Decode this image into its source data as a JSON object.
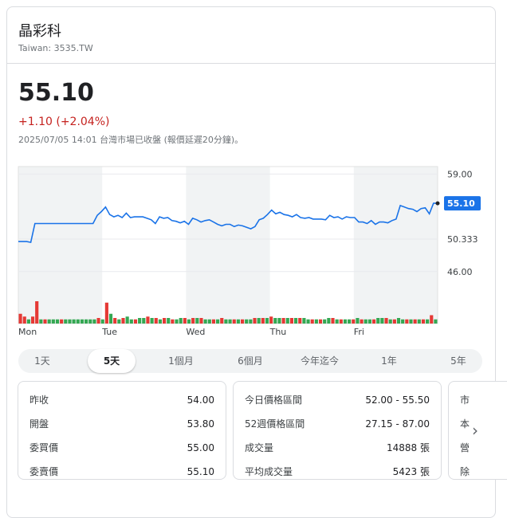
{
  "header": {
    "name": "晶彩科",
    "ticker": "Taiwan: 3535.TW"
  },
  "quote": {
    "price": "55.10",
    "change": "+1.10 (+2.04%)",
    "timestamp": "2025/07/05 14:01 台灣市場已收盤 (報價延遲20分鐘)。"
  },
  "colors": {
    "line": "#1a73e8",
    "up": "#e53935",
    "down": "#34a853",
    "band": "#f1f3f4"
  },
  "chart_data": {
    "type": "line",
    "ylim": [
      43,
      60
    ],
    "ytick_labels": [
      "59.00",
      "50.333",
      "46.00"
    ],
    "yticks": [
      59.0,
      50.333,
      46.0
    ],
    "x_labels": [
      "Mon",
      "Tue",
      "Wed",
      "Thu",
      "Fri"
    ],
    "last_price_label": "55.10",
    "grid": true,
    "series": [
      {
        "values": [
          50.0,
          50.0,
          50.0,
          49.9,
          52.4,
          52.4,
          52.4,
          52.4,
          52.4,
          52.4,
          52.4,
          52.4,
          52.4,
          52.4,
          52.4,
          52.4,
          52.4,
          52.4,
          52.4,
          53.5,
          54.0,
          54.6,
          53.6,
          53.3,
          53.5,
          53.2,
          53.8,
          53.2,
          53.3,
          53.3,
          53.3,
          53.1,
          52.9,
          52.4,
          53.3,
          53.1,
          53.2,
          52.8,
          52.7,
          52.5,
          52.7,
          52.3,
          53.1,
          52.9,
          52.6,
          52.8,
          52.9,
          52.6,
          52.3,
          52.1,
          52.3,
          52.3,
          52.0,
          52.2,
          52.1,
          51.9,
          51.7,
          52.0,
          52.9,
          53.1,
          53.6,
          54.2,
          53.7,
          53.9,
          53.6,
          53.5,
          53.3,
          53.6,
          53.2,
          53.1,
          53.2,
          53.0,
          53.0,
          53.0,
          52.9,
          53.5,
          53.2,
          53.3,
          53.0,
          53.3,
          53.2,
          53.2,
          52.6,
          52.6,
          52.4,
          52.8,
          52.3,
          52.6,
          52.6,
          52.5,
          52.8,
          53.0,
          54.8,
          54.6,
          54.4,
          54.3,
          54.0,
          54.4,
          54.5,
          53.7,
          55.1,
          55.1
        ]
      }
    ],
    "volume": {
      "up": [
        true,
        true,
        false,
        true,
        true,
        false,
        true,
        false,
        false,
        false,
        true,
        false,
        false,
        false,
        false,
        false,
        false,
        false,
        false,
        true,
        false,
        true,
        false,
        true,
        false,
        true,
        false,
        false,
        true,
        false,
        false,
        true,
        false,
        true,
        false,
        true,
        false,
        true,
        false,
        false,
        true,
        false,
        true,
        false,
        true,
        false,
        false,
        true,
        false,
        true,
        false,
        false,
        true,
        false,
        true,
        false,
        false,
        true,
        false,
        true,
        false,
        true,
        false,
        false,
        true,
        false,
        true,
        false,
        true,
        false,
        false,
        true,
        false,
        true,
        false,
        false,
        true,
        false,
        true,
        false,
        false,
        true,
        false,
        true,
        false,
        false,
        true,
        false,
        false,
        true,
        false,
        true,
        false,
        false,
        true,
        false,
        true,
        false,
        true,
        false,
        true,
        false
      ],
      "values": [
        0.35,
        0.25,
        0.15,
        0.25,
        0.8,
        0.15,
        0.15,
        0.15,
        0.15,
        0.15,
        0.15,
        0.15,
        0.15,
        0.15,
        0.15,
        0.15,
        0.15,
        0.15,
        0.15,
        0.2,
        0.15,
        0.75,
        0.35,
        0.2,
        0.15,
        0.2,
        0.25,
        0.15,
        0.15,
        0.2,
        0.2,
        0.25,
        0.2,
        0.2,
        0.15,
        0.2,
        0.2,
        0.15,
        0.15,
        0.2,
        0.2,
        0.15,
        0.2,
        0.2,
        0.2,
        0.15,
        0.15,
        0.15,
        0.15,
        0.2,
        0.15,
        0.15,
        0.15,
        0.15,
        0.15,
        0.15,
        0.15,
        0.2,
        0.2,
        0.2,
        0.2,
        0.25,
        0.2,
        0.2,
        0.2,
        0.2,
        0.2,
        0.2,
        0.2,
        0.2,
        0.15,
        0.15,
        0.15,
        0.15,
        0.15,
        0.2,
        0.2,
        0.15,
        0.15,
        0.15,
        0.15,
        0.15,
        0.2,
        0.15,
        0.15,
        0.15,
        0.15,
        0.2,
        0.2,
        0.2,
        0.15,
        0.15,
        0.2,
        0.15,
        0.15,
        0.15,
        0.15,
        0.15,
        0.15,
        0.15,
        0.3,
        0.15
      ]
    }
  },
  "range_tabs": [
    "1天",
    "5天",
    "1個月",
    "6個月",
    "今年迄今",
    "1年",
    "5年"
  ],
  "active_range": "5天",
  "stats_left": [
    {
      "label": "昨收",
      "value": "54.00"
    },
    {
      "label": "開盤",
      "value": "53.80"
    },
    {
      "label": "委買價",
      "value": "55.00"
    },
    {
      "label": "委賣價",
      "value": "55.10"
    }
  ],
  "stats_mid": [
    {
      "label": "今日價格區間",
      "value": "52.00 - 55.50"
    },
    {
      "label": "52週價格區間",
      "value": "27.15 - 87.00"
    },
    {
      "label": "成交量",
      "value": "14888 張"
    },
    {
      "label": "平均成交量",
      "value": "5423 張"
    }
  ],
  "stats_right": [
    {
      "label": "市"
    },
    {
      "label": "本"
    },
    {
      "label": "營"
    },
    {
      "label": "除"
    }
  ],
  "next_icon": "›"
}
